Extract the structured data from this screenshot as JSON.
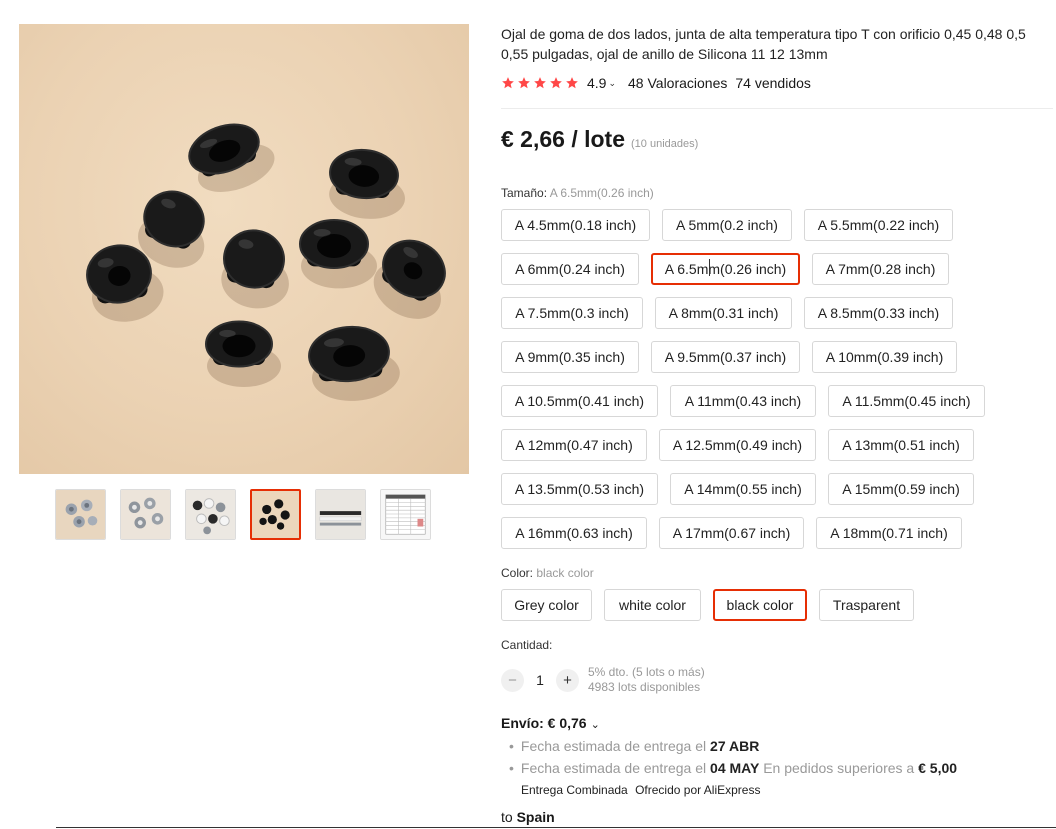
{
  "product": {
    "title": "Ojal de goma de dos lados, junta de alta temperatura tipo T con orificio 0,45 0,48 0,5 0,55 pulgadas, ojal de anillo de Silicona 11 12 13mm",
    "rating_stars": 5,
    "rating_value": "4.9",
    "reviews": "48 Valoraciones",
    "sold": "74 vendidos",
    "price": "€ 2,66 / lote",
    "price_unit": "(10 unidades)",
    "star_color": "#ff4747",
    "accent_color": "#e62e04"
  },
  "gallery": {
    "thumbnails": [
      {
        "name": "thumbnail-1",
        "active": false
      },
      {
        "name": "thumbnail-2",
        "active": false
      },
      {
        "name": "thumbnail-3",
        "active": false
      },
      {
        "name": "thumbnail-4",
        "active": true
      },
      {
        "name": "thumbnail-5",
        "active": false
      },
      {
        "name": "thumbnail-6",
        "active": false
      }
    ]
  },
  "size": {
    "label": "Tamaño:",
    "selected": "A 6.5mm(0.26 inch)",
    "options": [
      "A 4.5mm(0.18 inch)",
      "A 5mm(0.2 inch)",
      "A 5.5mm(0.22 inch)",
      "A 6mm(0.24 inch)",
      "A 6.5mm(0.26 inch)",
      "A 7mm(0.28 inch)",
      "A 7.5mm(0.3 inch)",
      "A 8mm(0.31 inch)",
      "A 8.5mm(0.33 inch)",
      "A 9mm(0.35 inch)",
      "A 9.5mm(0.37 inch)",
      "A 10mm(0.39 inch)",
      "A 10.5mm(0.41 inch)",
      "A 11mm(0.43 inch)",
      "A 11.5mm(0.45 inch)",
      "A 12mm(0.47 inch)",
      "A 12.5mm(0.49 inch)",
      "A 13mm(0.51 inch)",
      "A 13.5mm(0.53 inch)",
      "A 14mm(0.55 inch)",
      "A 15mm(0.59 inch)",
      "A 16mm(0.63 inch)",
      "A 17mm(0.67 inch)",
      "A 18mm(0.71 inch)"
    ]
  },
  "color": {
    "label": "Color:",
    "selected": "black color",
    "options": [
      "Grey color",
      "white color",
      "black color",
      "Trasparent"
    ]
  },
  "quantity": {
    "label": "Cantidad:",
    "value": "1",
    "minus": "−",
    "plus": "+",
    "discount": "5% dto. (5 lots o más)",
    "available": "4983 lots disponibles"
  },
  "shipping": {
    "label": "Envío: € 0,76",
    "delivery1_text": "Fecha estimada de entrega el",
    "delivery1_date": "27 ABR",
    "delivery2_text": "Fecha estimada de entrega el",
    "delivery2_date": "04 MAY",
    "delivery2_cond": "En pedidos superiores a",
    "delivery2_amount": "€ 5,00",
    "combined": "Entrega Combinada",
    "offered": "Ofrecido por AliExpress",
    "to_prefix": "to",
    "country": "Spain"
  }
}
